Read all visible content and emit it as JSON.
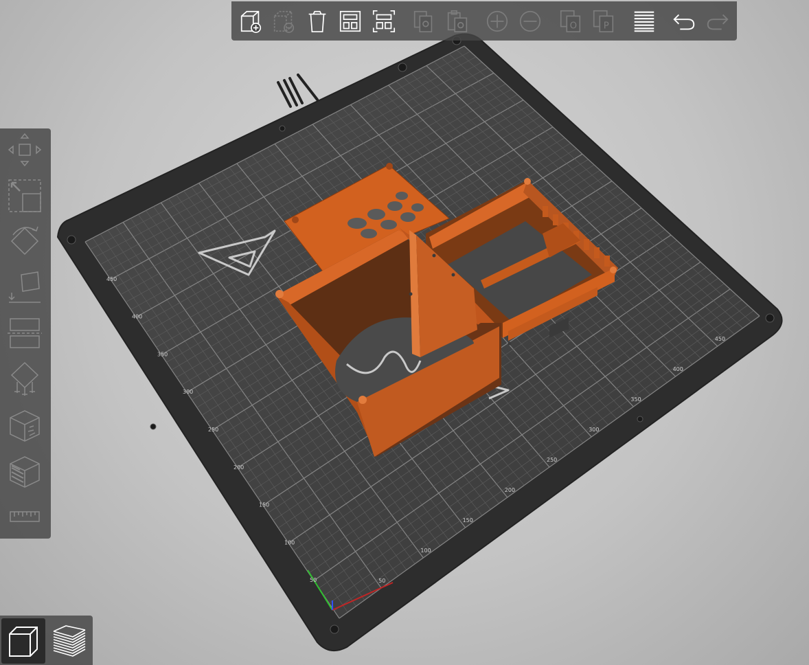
{
  "app": "3D printer slicer – plater view",
  "toolbar": {
    "items": [
      {
        "id": "add",
        "label": "Add",
        "icon": "add-object-icon",
        "enabled": true
      },
      {
        "id": "delete",
        "label": "Delete",
        "icon": "delete-object-icon",
        "enabled": false
      },
      {
        "id": "delete_all",
        "label": "Delete all",
        "icon": "trash-icon",
        "enabled": true
      },
      {
        "id": "arrange",
        "label": "Arrange",
        "icon": "arrange-icon",
        "enabled": true
      },
      {
        "id": "arrange_selection",
        "label": "Arrange selection",
        "icon": "arrange-selection-icon",
        "enabled": true
      },
      {
        "id": "copy",
        "label": "Copy",
        "icon": "copy-icon",
        "enabled": false
      },
      {
        "id": "paste",
        "label": "Paste",
        "icon": "paste-icon",
        "enabled": false
      },
      {
        "id": "add_instance",
        "label": "Add instance",
        "icon": "plus-circle-icon",
        "enabled": false
      },
      {
        "id": "remove_instance",
        "label": "Remove instance",
        "icon": "minus-circle-icon",
        "enabled": false
      },
      {
        "id": "split_objects",
        "label": "Split to objects",
        "icon": "split-objects-icon",
        "enabled": false
      },
      {
        "id": "split_parts",
        "label": "Split to parts",
        "icon": "split-parts-icon",
        "enabled": false
      },
      {
        "id": "layers",
        "label": "Variable layer height",
        "icon": "layers-edit-icon",
        "enabled": true
      },
      {
        "id": "undo",
        "label": "Undo",
        "icon": "undo-icon",
        "enabled": true
      },
      {
        "id": "redo",
        "label": "Redo",
        "icon": "redo-icon",
        "enabled": false
      }
    ]
  },
  "gizmos": {
    "items": [
      {
        "id": "move",
        "label": "Move",
        "icon": "move-icon"
      },
      {
        "id": "scale",
        "label": "Scale",
        "icon": "scale-icon"
      },
      {
        "id": "rotate",
        "label": "Rotate",
        "icon": "rotate-icon"
      },
      {
        "id": "place_on_face",
        "label": "Place on face",
        "icon": "place-on-face-icon"
      },
      {
        "id": "cut",
        "label": "Cut",
        "icon": "cut-icon"
      },
      {
        "id": "supports",
        "label": "Paint-on supports",
        "icon": "supports-icon"
      },
      {
        "id": "seam",
        "label": "Seam painting",
        "icon": "seam-icon"
      },
      {
        "id": "mmu",
        "label": "Multimaterial painting",
        "icon": "mmu-segmentation-icon"
      },
      {
        "id": "measure",
        "label": "Measure",
        "icon": "ruler-icon"
      }
    ]
  },
  "view_toggle": {
    "items": [
      {
        "id": "3d",
        "label": "3D view",
        "icon": "cube-3d-view-icon",
        "active": true
      },
      {
        "id": "preview",
        "label": "Preview",
        "icon": "layers-preview-icon",
        "active": false
      }
    ]
  },
  "bed": {
    "axis_labels": [
      "50",
      "100",
      "150",
      "200",
      "250",
      "300",
      "350",
      "400",
      "450"
    ],
    "colors": {
      "grid": "#858585",
      "plate": "#3a3a3a",
      "frame": "#2b2b2b",
      "model": "#d2611f",
      "model_dark": "#6f3717"
    }
  }
}
